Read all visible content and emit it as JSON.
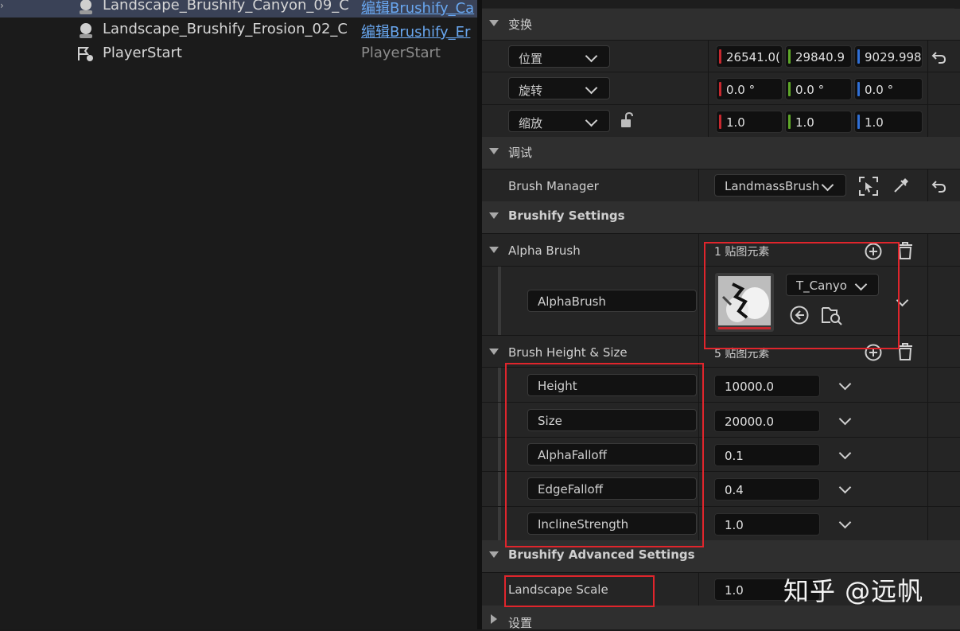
{
  "outliner": {
    "rows": [
      {
        "name": "Landscape_Brushify_Canyon_09_C",
        "type": "编辑Brushify_Ca",
        "icon": "brush-actor-icon"
      },
      {
        "name": "Landscape_Brushify_Erosion_02_C",
        "type": "编辑Brushify_Er",
        "icon": "brush-actor-icon"
      },
      {
        "name": "PlayerStart",
        "type": "PlayerStart",
        "icon": "player-start-icon"
      }
    ]
  },
  "details": {
    "transform": {
      "header": "变换",
      "location": {
        "label": "位置",
        "x": "26541.0(",
        "y": "29840.9",
        "z": "9029.998"
      },
      "rotation": {
        "label": "旋转",
        "x": "0.0 °",
        "y": "0.0 °",
        "z": "0.0 °"
      },
      "scale": {
        "label": "缩放",
        "x": "1.0",
        "y": "1.0",
        "z": "1.0"
      }
    },
    "debug": {
      "header": "调试",
      "brush_manager_label": "Brush Manager",
      "brush_manager_value": "LandmassBrush"
    },
    "brushify_settings": {
      "header": "Brushify Settings"
    },
    "alpha_brush": {
      "label": "Alpha Brush",
      "count": "1 贴图元素",
      "element_label": "AlphaBrush",
      "texture_name": "T_Canyo"
    },
    "height_size": {
      "label": "Brush Height & Size",
      "count": "5 贴图元素",
      "items": [
        {
          "label": "Height",
          "value": "10000.0"
        },
        {
          "label": "Size",
          "value": "20000.0"
        },
        {
          "label": "AlphaFalloff",
          "value": "0.1"
        },
        {
          "label": "EdgeFalloff",
          "value": "0.4"
        },
        {
          "label": "InclineStrength",
          "value": "1.0"
        }
      ]
    },
    "advanced": {
      "header": "Brushify Advanced Settings",
      "landscape_scale_label": "Landscape Scale",
      "landscape_scale_value": "1.0"
    },
    "settings": {
      "header": "设置"
    }
  },
  "axis_colors": {
    "x": "#c8282f",
    "y": "#5fa829",
    "z": "#2f6fd6"
  },
  "highlight_color": "#e0252c",
  "watermark": "知乎 @远帆"
}
